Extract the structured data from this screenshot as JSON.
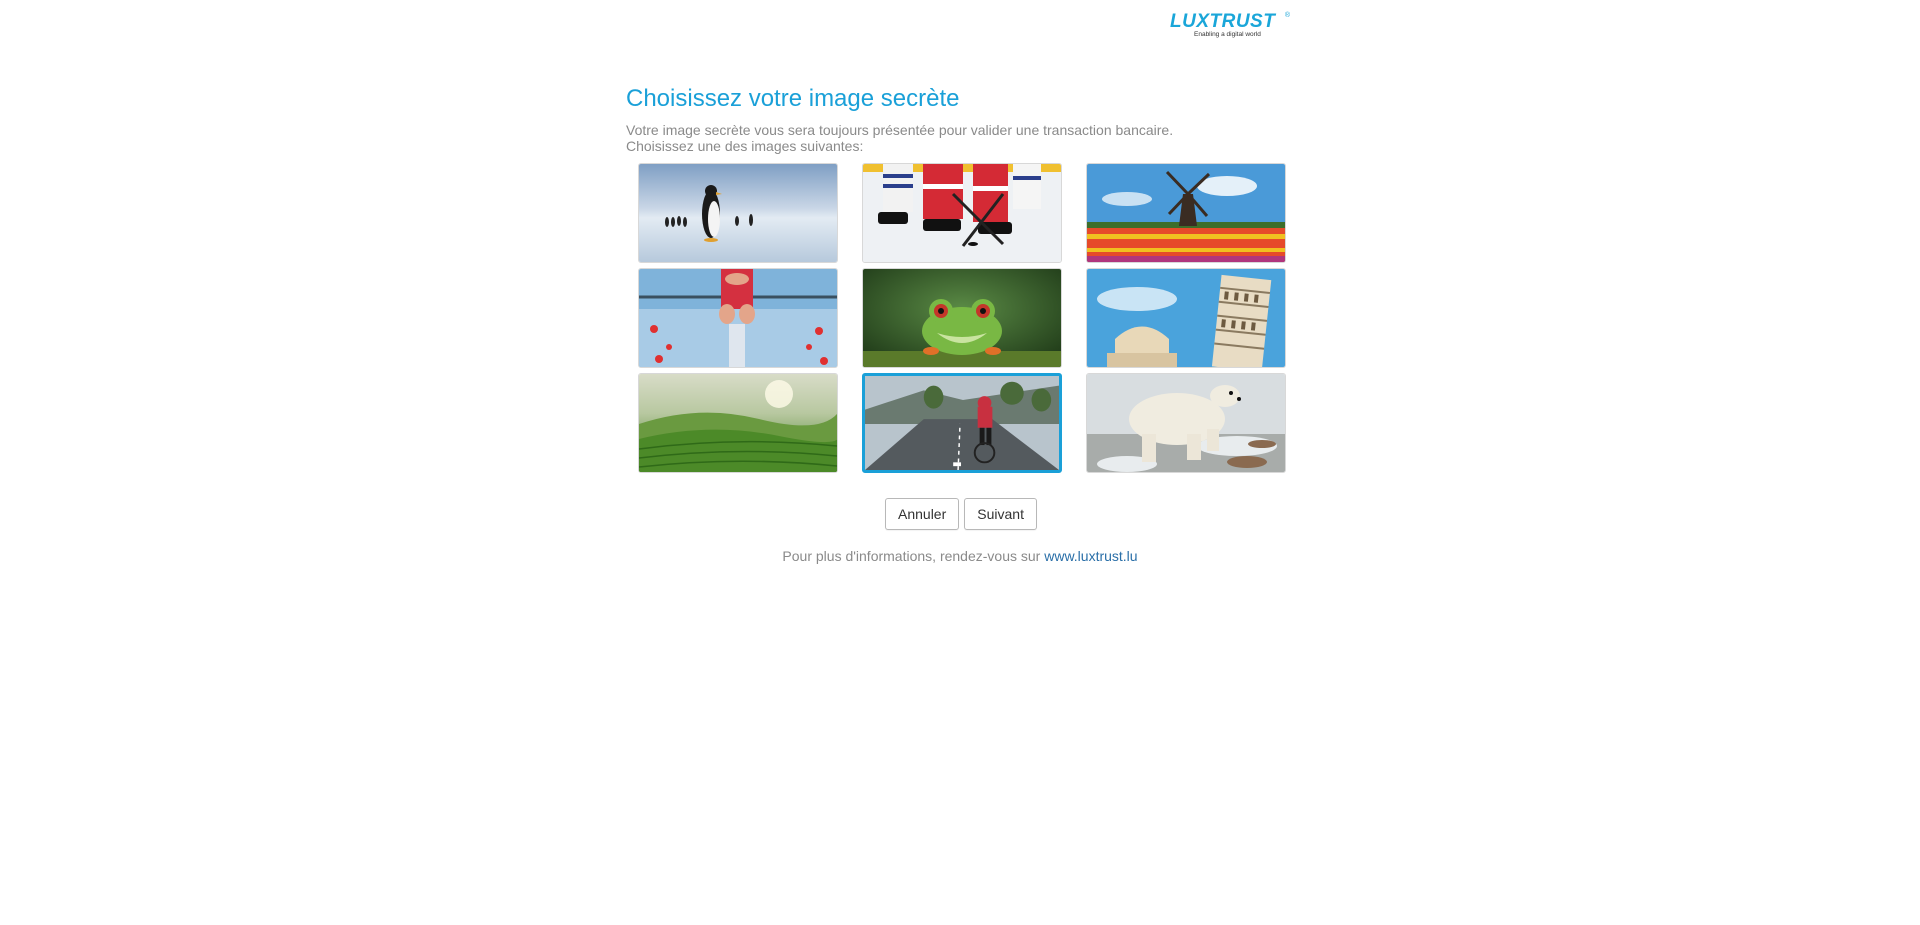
{
  "logo": {
    "wordmark": "LUXTRUST",
    "registered": "®",
    "tagline": "Enabling a digital world"
  },
  "header": {
    "title": "Choisissez votre image secrète",
    "description_line1": "Votre image secrète vous sera toujours présentée pour valider une transaction bancaire.",
    "description_line2": "Choisissez une des images suivantes:"
  },
  "images": [
    {
      "subject": "penguins",
      "selected": false
    },
    {
      "subject": "ice-hockey",
      "selected": false
    },
    {
      "subject": "windmill-tulips",
      "selected": false
    },
    {
      "subject": "rowing",
      "selected": false
    },
    {
      "subject": "frog",
      "selected": false
    },
    {
      "subject": "leaning-tower-of-pisa",
      "selected": false
    },
    {
      "subject": "tea-field",
      "selected": false
    },
    {
      "subject": "cyclist",
      "selected": true
    },
    {
      "subject": "polar-bear",
      "selected": false
    }
  ],
  "colors": {
    "accent": "#1aa0d8",
    "link": "#2a6fa8",
    "muted_text": "#8a8a8a"
  },
  "actions": {
    "cancel_label": "Annuler",
    "next_label": "Suivant"
  },
  "footer": {
    "text": "Pour plus d'informations, rendez-vous sur",
    "link_text": "www.luxtrust.lu"
  }
}
